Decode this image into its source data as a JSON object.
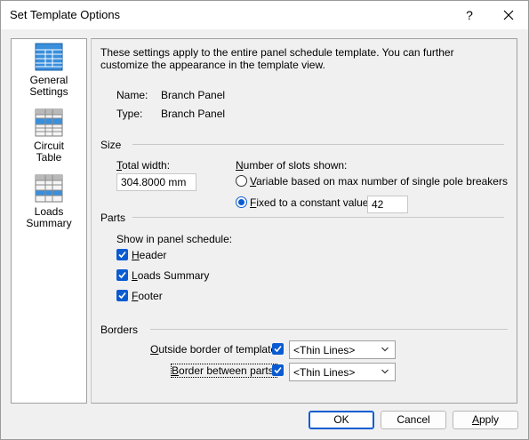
{
  "window": {
    "title": "Set Template Options",
    "help_label": "?"
  },
  "sidebar": {
    "items": [
      {
        "label": "General Settings",
        "line1": "General",
        "line2": "Settings",
        "selected": true
      },
      {
        "label": "Circuit Table",
        "line1": "Circuit",
        "line2": "Table",
        "selected": false
      },
      {
        "label": "Loads Summary",
        "line1": "Loads",
        "line2": "Summary",
        "selected": false
      }
    ]
  },
  "description": "These settings apply to the entire panel schedule template. You can further customize the appearance in the template view.",
  "info": {
    "name_label": "Name:",
    "name_value": "Branch Panel",
    "type_label": "Type:",
    "type_value": "Branch Panel"
  },
  "size": {
    "section_label": "Size",
    "total_width_label_u": "T",
    "total_width_label_rest": "otal width:",
    "total_width_value": "304.8000 mm",
    "slots_label_u": "N",
    "slots_label_rest": "umber of slots shown:",
    "radio_variable_u": "V",
    "radio_variable_rest": "ariable based on max number of single pole breakers",
    "radio_fixed_u": "F",
    "radio_fixed_rest": "ixed to a constant value:",
    "fixed_value": "42",
    "selected_option": "fixed"
  },
  "parts": {
    "section_label": "Parts",
    "show_label": "Show in panel schedule:",
    "header_u": "H",
    "header_rest": "eader",
    "loads_u": "L",
    "loads_rest": "oads Summary",
    "footer_u": "F",
    "footer_rest": "ooter",
    "header_checked": true,
    "loads_checked": true,
    "footer_checked": true
  },
  "borders": {
    "section_label": "Borders",
    "outside_label_u": "O",
    "outside_label_rest": "utside border of template:",
    "outside_checked": true,
    "outside_value": "<Thin Lines>",
    "between_label_u": "B",
    "between_label_rest": "order between parts:",
    "between_checked": true,
    "between_value": "<Thin Lines>"
  },
  "footer": {
    "ok_label": "OK",
    "cancel_label": "Cancel",
    "apply_label_u": "A",
    "apply_label_rest": "pply"
  },
  "colors": {
    "accent": "#0a5bd1",
    "background": "#f0f0f0",
    "icon_blue": "#3a8fdc"
  }
}
